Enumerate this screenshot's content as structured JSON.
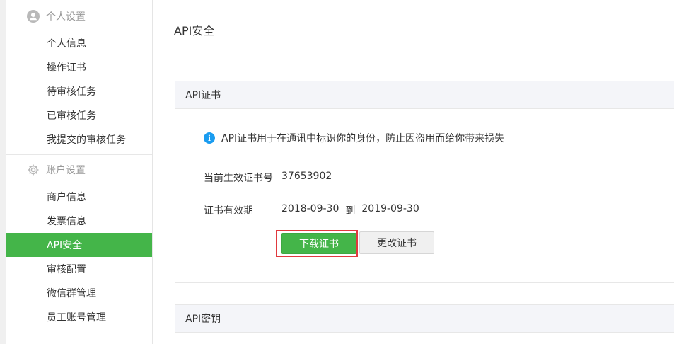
{
  "sidebar": {
    "groups": [
      {
        "title": "个人设置",
        "icon": "user-circle-icon",
        "items": [
          "个人信息",
          "操作证书",
          "待审核任务",
          "已审核任务",
          "我提交的审核任务"
        ]
      },
      {
        "title": "账户设置",
        "icon": "gear-icon",
        "items": [
          "商户信息",
          "发票信息",
          "API安全",
          "审核配置",
          "微信群管理",
          "员工账号管理"
        ]
      }
    ],
    "active_item": "API安全"
  },
  "main": {
    "page_title": "API安全",
    "cert_panel": {
      "title": "API证书",
      "tip": "API证书用于在通讯中标识你的身份，防止因盗用而给你带来损失",
      "current_cert_label": "当前生效证书号",
      "current_cert_value": "37653902",
      "validity_label": "证书有效期",
      "validity_start": "2018-09-30",
      "validity_sep": "到",
      "validity_end": "2019-09-30",
      "download_button": "下载证书",
      "change_button": "更改证书"
    },
    "key_panel": {
      "title": "API密钥"
    }
  },
  "colors": {
    "accent": "#44b549",
    "highlight": "#e0393e",
    "info": "#1a9cf0"
  }
}
